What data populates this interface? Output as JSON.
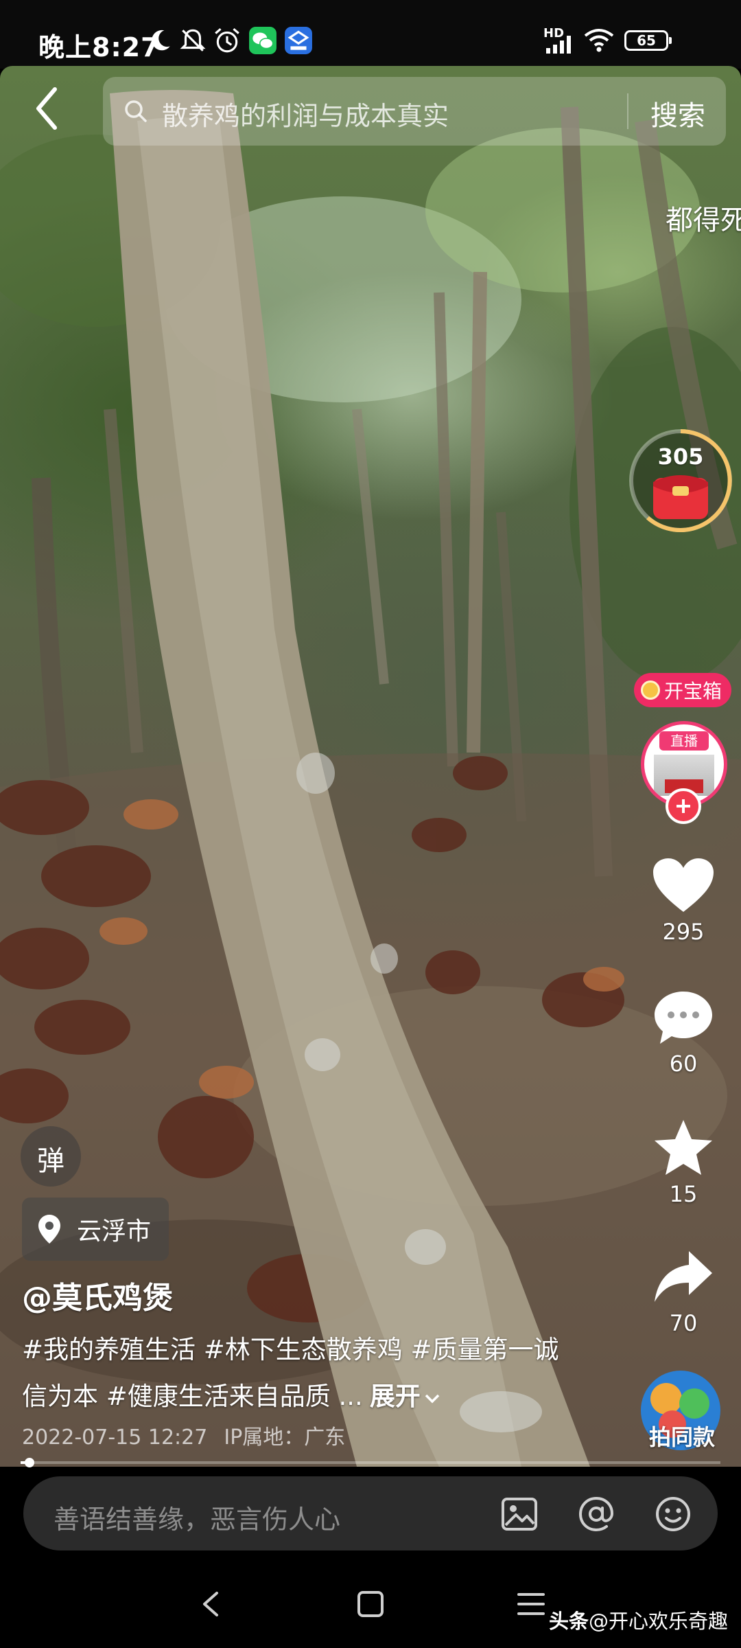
{
  "status_bar": {
    "time": "晚上8:27",
    "network": "HD",
    "battery": "65",
    "icons": [
      "moon-icon",
      "mute-icon",
      "alarm-icon",
      "wechat-icon",
      "app-icon",
      "signal-icon",
      "wifi-icon",
      "battery-icon"
    ]
  },
  "search": {
    "query": "散养鸡的利润与成本真实",
    "button": "搜索"
  },
  "floating_text": "都得死",
  "red_packet": {
    "count": "305"
  },
  "actions": {
    "treasure_label": "开宝箱",
    "live_label": "直播",
    "likes": "295",
    "comments": "60",
    "favorites": "15",
    "shares": "70",
    "same_style": "拍同款"
  },
  "danmu_label": "弹",
  "location": "云浮市",
  "author": "@莫氏鸡煲",
  "description": "#我的养殖生活 #林下生态散养鸡 #质量第一诚信为本 #健康生活来自品质 ...",
  "expand_label": "展开",
  "meta": {
    "date": "2022-07-15 12:27",
    "ip": "IP属地：广东"
  },
  "progress": {
    "fraction": 0.013
  },
  "comment_bar": {
    "placeholder": "善语结善缘，恶言伤人心"
  },
  "watermark": {
    "app": "头条",
    "handle": "@开心欢乐奇趣"
  },
  "colors": {
    "accent_pink": "#f03a73",
    "comment_bar_bg": "#2b2b2b",
    "status_bar_bg": "#0b0b0b"
  }
}
